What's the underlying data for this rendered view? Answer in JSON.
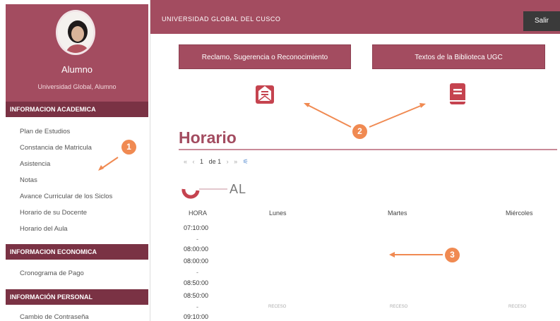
{
  "topbar": {
    "title": "UNIVERSIDAD GLOBAL DEL CUSCO",
    "logout_label": "Salir"
  },
  "sidebar": {
    "profile_name": "Alumno",
    "profile_sub": "Universidad Global, Alumno",
    "sections": [
      {
        "title": "INFORMACION ACADEMICA",
        "items": [
          "Plan de Estudios",
          "Constancia de Matricula",
          "Asistencia",
          "Notas",
          "Avance Curricular de los Siclos",
          "Horario de su Docente",
          "Horario del Aula"
        ]
      },
      {
        "title": "INFORMACION ECONOMICA",
        "items": [
          "Cronograma de Pago"
        ]
      },
      {
        "title": "INFORMACIÓN PERSONAL",
        "items": [
          "Cambio de Contraseña"
        ]
      }
    ]
  },
  "buttons": {
    "claim": "Reclamo, Sugerencia o Reconocimiento",
    "library": "Textos de la Biblioteca UGC"
  },
  "main": {
    "title": "Horario",
    "pager": {
      "current": "1",
      "of_label": "de 1"
    },
    "logo_text": "AL",
    "columns": [
      "HORA",
      "Lunes",
      "Martes",
      "Miércoles"
    ],
    "times": [
      "07:10:00",
      "08:00:00",
      "08:00:00",
      "08:50:00",
      "08:50:00",
      "09:10:00"
    ],
    "cell_text": "RECESO"
  },
  "annotations": [
    "1",
    "2",
    "3"
  ],
  "colors": {
    "accent": "#a34c60",
    "accent_dark": "#7a3244",
    "badge": "#f08a52"
  }
}
